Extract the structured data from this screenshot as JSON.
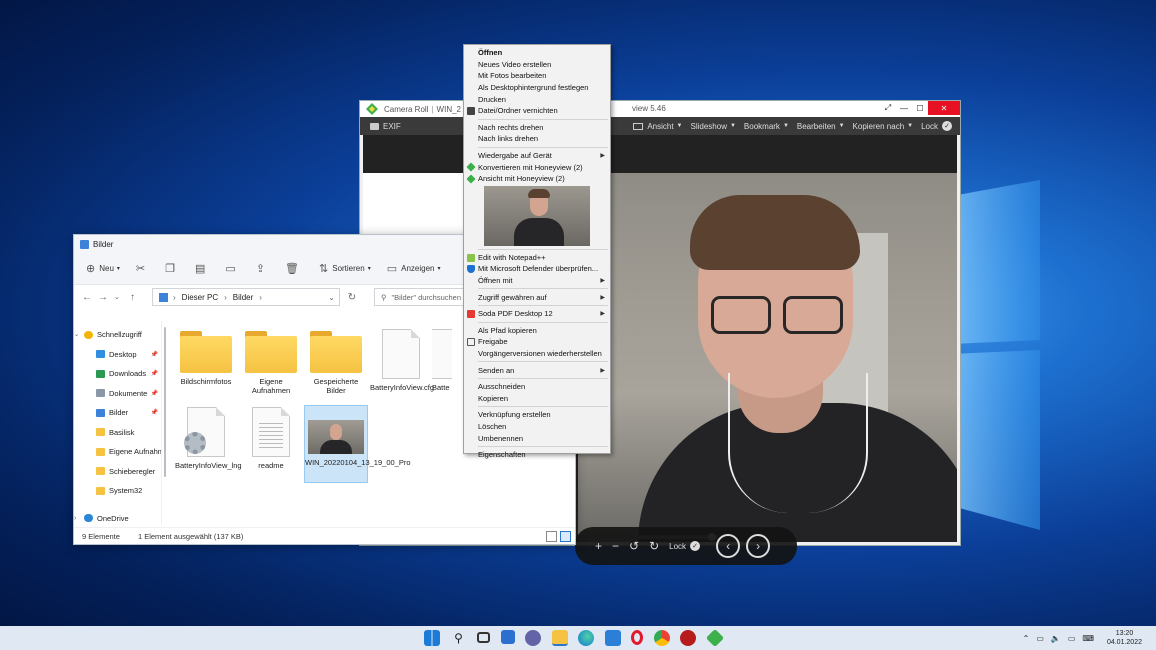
{
  "honeyview": {
    "title_left": "Camera Roll",
    "title_mid": "WIN_2",
    "title_right": "view 5.46",
    "toolbar": {
      "exif": "EXIF",
      "ansicht": "Ansicht",
      "slideshow": "Slideshow",
      "bookmark": "Bookmark",
      "bearbeiten": "Bearbeiten",
      "kopieren_nach": "Kopieren nach",
      "lock": "Lock"
    },
    "controls": {
      "lock": "Lock"
    }
  },
  "explorer": {
    "title": "Bilder",
    "commands": {
      "neu": "Neu",
      "sortieren": "Sortieren",
      "anzeigen": "Anzeigen"
    },
    "path": {
      "root": "Dieser PC",
      "folder": "Bilder"
    },
    "search_placeholder": "\"Bilder\" durchsuchen",
    "nav": [
      {
        "label": "Schnellzugriff",
        "color": "#f2b600",
        "pinned": false
      },
      {
        "label": "Desktop",
        "color": "#2f8ee0",
        "pinned": true
      },
      {
        "label": "Downloads",
        "color": "#2a9a52",
        "pinned": true
      },
      {
        "label": "Dokumente",
        "color": "#8a97a6",
        "pinned": true
      },
      {
        "label": "Bilder",
        "color": "#3b82d8",
        "pinned": true
      },
      {
        "label": "Basilisk",
        "color": "#f5c242",
        "pinned": false
      },
      {
        "label": "Eigene Aufnahmen",
        "color": "#f5c242",
        "pinned": false
      },
      {
        "label": "Schieberegler",
        "color": "#f5c242",
        "pinned": false
      },
      {
        "label": "System32",
        "color": "#f5c242",
        "pinned": false
      },
      {
        "label": "",
        "color": "",
        "pinned": false
      },
      {
        "label": "OneDrive",
        "color": "#2a86d6",
        "pinned": false
      }
    ],
    "files": {
      "f1": "Bildschirmfotos",
      "f2": "Eigene Aufnahmen",
      "f3": "Gespeicherte Bilder",
      "f4": "BatteryInfoView.cfg",
      "f5": "Batte",
      "f6": "BatteryInfoView_lng",
      "f7": "readme",
      "f8": "WIN_20220104_13_19_00_Pro"
    },
    "status": {
      "count": "9 Elemente",
      "selected": "1 Element ausgewählt (137 KB)"
    }
  },
  "context_menu": {
    "offnen": "Öffnen",
    "neues_video": "Neues Video erstellen",
    "mit_fotos": "Mit Fotos bearbeiten",
    "hintergrund": "Als Desktophintergrund festlegen",
    "drucken": "Drucken",
    "vernichten": "Datei/Ordner vernichten",
    "rechts": "Nach rechts drehen",
    "links": "Nach links drehen",
    "wiedergabe": "Wiedergabe auf Gerät",
    "konvertieren": "Konvertieren mit Honeyview (2)",
    "ansicht_hv": "Ansicht mit Honeyview (2)",
    "notepad": "Edit with Notepad++",
    "defender": "Mit Microsoft Defender überprüfen...",
    "offnen_mit": "Öffnen mit",
    "zugriff": "Zugriff gewähren auf",
    "soda": "Soda PDF Desktop 12",
    "pfad": "Als Pfad kopieren",
    "freigabe": "Freigabe",
    "vorgaenger": "Vorgängerversionen wiederherstellen",
    "senden": "Senden an",
    "ausschneiden": "Ausschneiden",
    "kopieren": "Kopieren",
    "verknuepfung": "Verknüpfung erstellen",
    "loeschen": "Löschen",
    "umbenennen": "Umbenennen",
    "eigenschaften": "Eigenschaften"
  },
  "taskbar": {
    "icons": [
      "windows-start-icon",
      "search-icon",
      "task-view-icon",
      "widgets-icon",
      "teams-chat-icon",
      "file-explorer-icon",
      "edge-icon",
      "store-icon",
      "opera-icon",
      "chrome-icon",
      "app-icon",
      "honeyview-icon"
    ],
    "time": "13:20",
    "date": "04.01.2022"
  },
  "colors": {
    "accent": "#2a75d0",
    "taskbar": "#dfe8f3",
    "close_button": "#e81123"
  }
}
